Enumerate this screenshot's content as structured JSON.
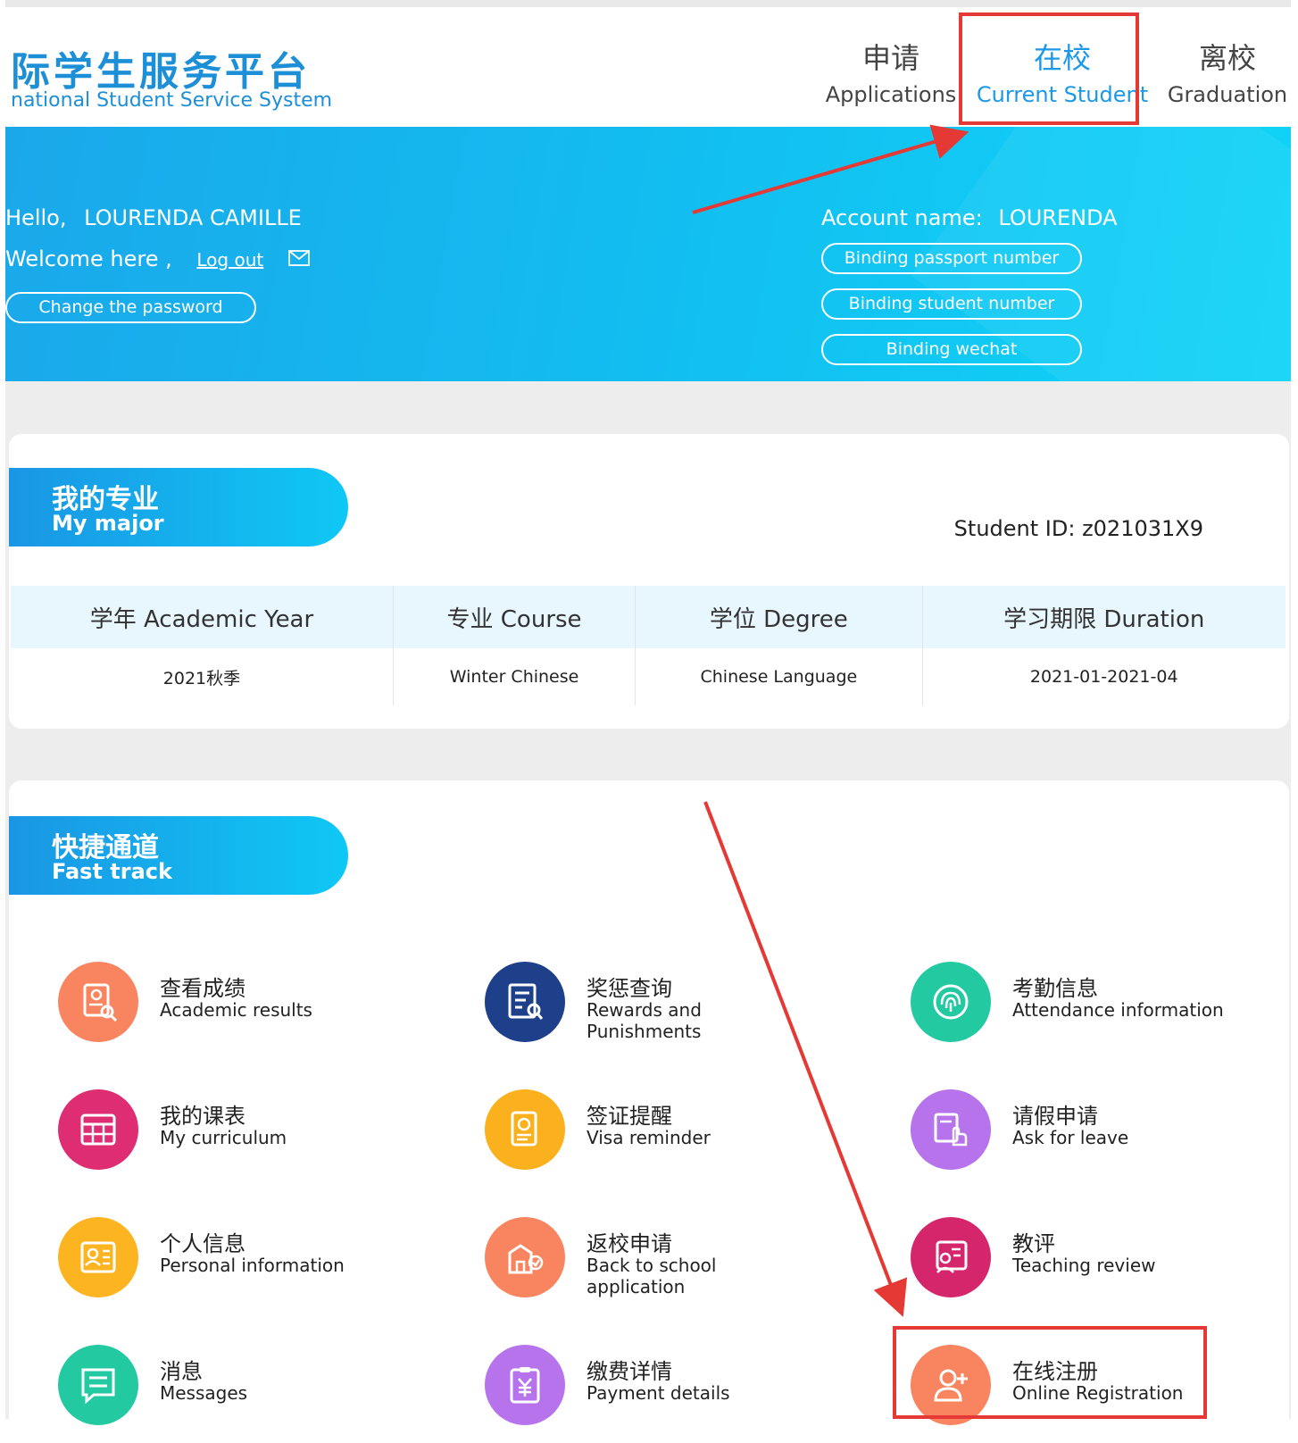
{
  "header": {
    "logo_cn": "际学生服务平台",
    "logo_en": "national Student Service System",
    "nav": [
      {
        "cn": "申请",
        "en": "Applications"
      },
      {
        "cn": "在校",
        "en": "Current Student"
      },
      {
        "cn": "离校",
        "en": "Graduation"
      }
    ],
    "active_nav": "Current Student"
  },
  "banner": {
    "hello_prefix": "Hello,",
    "user_name": "LOURENDA CAMILLE",
    "welcome": "Welcome here ,",
    "logout": "Log out",
    "change_password": "Change the password",
    "account_label": "Account name:",
    "account_name": "LOURENDA",
    "bind_passport": "Binding passport number",
    "bind_student": "Binding student number",
    "bind_wechat": "Binding wechat"
  },
  "major": {
    "title_cn": "我的专业",
    "title_en": "My major",
    "student_id_label": "Student ID:",
    "student_id": "z021031X9",
    "columns": [
      "学年 Academic Year",
      "专业 Course",
      "学位 Degree",
      "学习期限 Duration"
    ],
    "row": [
      "2021秋季",
      "Winter Chinese",
      "Chinese Language",
      "2021-01-2021-04"
    ]
  },
  "fast_track": {
    "title_cn": "快捷通道",
    "title_en": "Fast track",
    "items": [
      {
        "cn": "查看成绩",
        "en": "Academic results",
        "color": "#f8855f",
        "icon": "report-icon"
      },
      {
        "cn": "奖惩查询",
        "en": "Rewards and Punishments",
        "color": "#1e3f8a",
        "icon": "document-search-icon"
      },
      {
        "cn": "考勤信息",
        "en": "Attendance information",
        "color": "#23c9a0",
        "icon": "fingerprint-icon"
      },
      {
        "cn": "我的课表",
        "en": "My curriculum",
        "color": "#de2d73",
        "icon": "calendar-grid-icon"
      },
      {
        "cn": "签证提醒",
        "en": "Visa reminder",
        "color": "#fbb01d",
        "icon": "passport-icon"
      },
      {
        "cn": "请假申请",
        "en": "Ask for leave",
        "color": "#b673ec",
        "icon": "hand-raise-icon"
      },
      {
        "cn": "个人信息",
        "en": "Personal information",
        "color": "#fdb421",
        "icon": "id-card-icon"
      },
      {
        "cn": "返校申请",
        "en": "Back to school application",
        "color": "#f8855f",
        "icon": "school-building-icon"
      },
      {
        "cn": "教评",
        "en": "Teaching review",
        "color": "#d6266b",
        "icon": "teacher-board-icon"
      },
      {
        "cn": "消息",
        "en": "Messages",
        "color": "#23c9a0",
        "icon": "message-icon"
      },
      {
        "cn": "缴费详情",
        "en": "Payment details",
        "color": "#b673ec",
        "icon": "yuan-receipt-icon"
      },
      {
        "cn": "在线注册",
        "en": "Online Registration",
        "color": "#f8855f",
        "icon": "add-user-icon"
      }
    ]
  }
}
